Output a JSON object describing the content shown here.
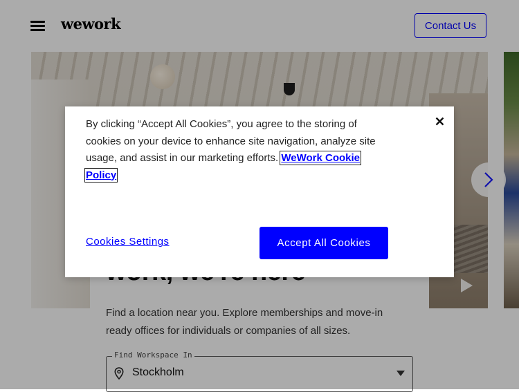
{
  "header": {
    "logo_text": "wework",
    "contact_label": "Contact Us"
  },
  "hero": {
    "headline": "work, we're here",
    "description": "Find a location near you. Explore memberships and move-in ready offices for individuals or companies of all sizes.",
    "location_field": {
      "legend": "Find Workspace In",
      "value": "Stockholm"
    }
  },
  "cookie_banner": {
    "message": "By clicking “Accept All Cookies”, you agree to the storing of cookies on your device to enhance site navigation, analyze site usage, and assist in our marketing efforts.",
    "policy_link": "WeWork Cookie Policy",
    "settings_label": "Cookies Settings",
    "accept_label": "Accept All Cookies",
    "close_icon": "close-icon"
  },
  "icons": {
    "menu": "hamburger-menu-icon",
    "next": "chevron-right-icon",
    "play": "play-icon",
    "location": "map-pin-icon",
    "dropdown": "caret-down-icon"
  },
  "colors": {
    "brand_blue": "#0000ff",
    "overlay": "rgba(0,0,0,0.33)"
  }
}
